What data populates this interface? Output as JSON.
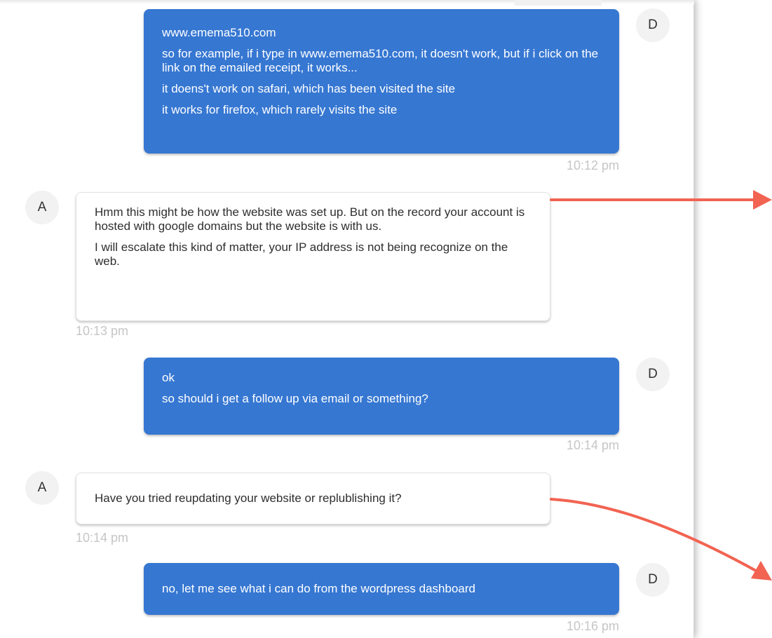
{
  "messages": [
    {
      "sender": "D",
      "lines": [
        "www.emema510.com",
        "so for example, if i type in www.emema510.com, it doesn't work, but if i click on the link on the emailed receipt, it works...",
        "it doens't work on safari, which has been visited the site",
        "it works for firefox, which rarely visits the site"
      ],
      "time": "10:12 pm"
    },
    {
      "sender": "A",
      "lines": [
        "Hmm this might be how the website was set up. But on the record your account is hosted with google domains but the website is with us.",
        "I will escalate this kind of matter, your IP address is not being recognize on the web."
      ],
      "time": "10:13 pm"
    },
    {
      "sender": "D",
      "lines": [
        "ok",
        "so should i get a follow up via email or something?"
      ],
      "time": "10:14 pm"
    },
    {
      "sender": "A",
      "lines": [
        "Have you tried reupdating your website or replublishing it?"
      ],
      "time": "10:14 pm"
    },
    {
      "sender": "D",
      "lines": [
        "no, let me see what i can do from the wordpress dashboard"
      ],
      "time": "10:16 pm"
    }
  ],
  "colors": {
    "user_bubble": "#3677d2",
    "agent_bubble": "#ffffff",
    "annotation_arrow": "#f26352",
    "timestamp": "#c6c6c6"
  }
}
